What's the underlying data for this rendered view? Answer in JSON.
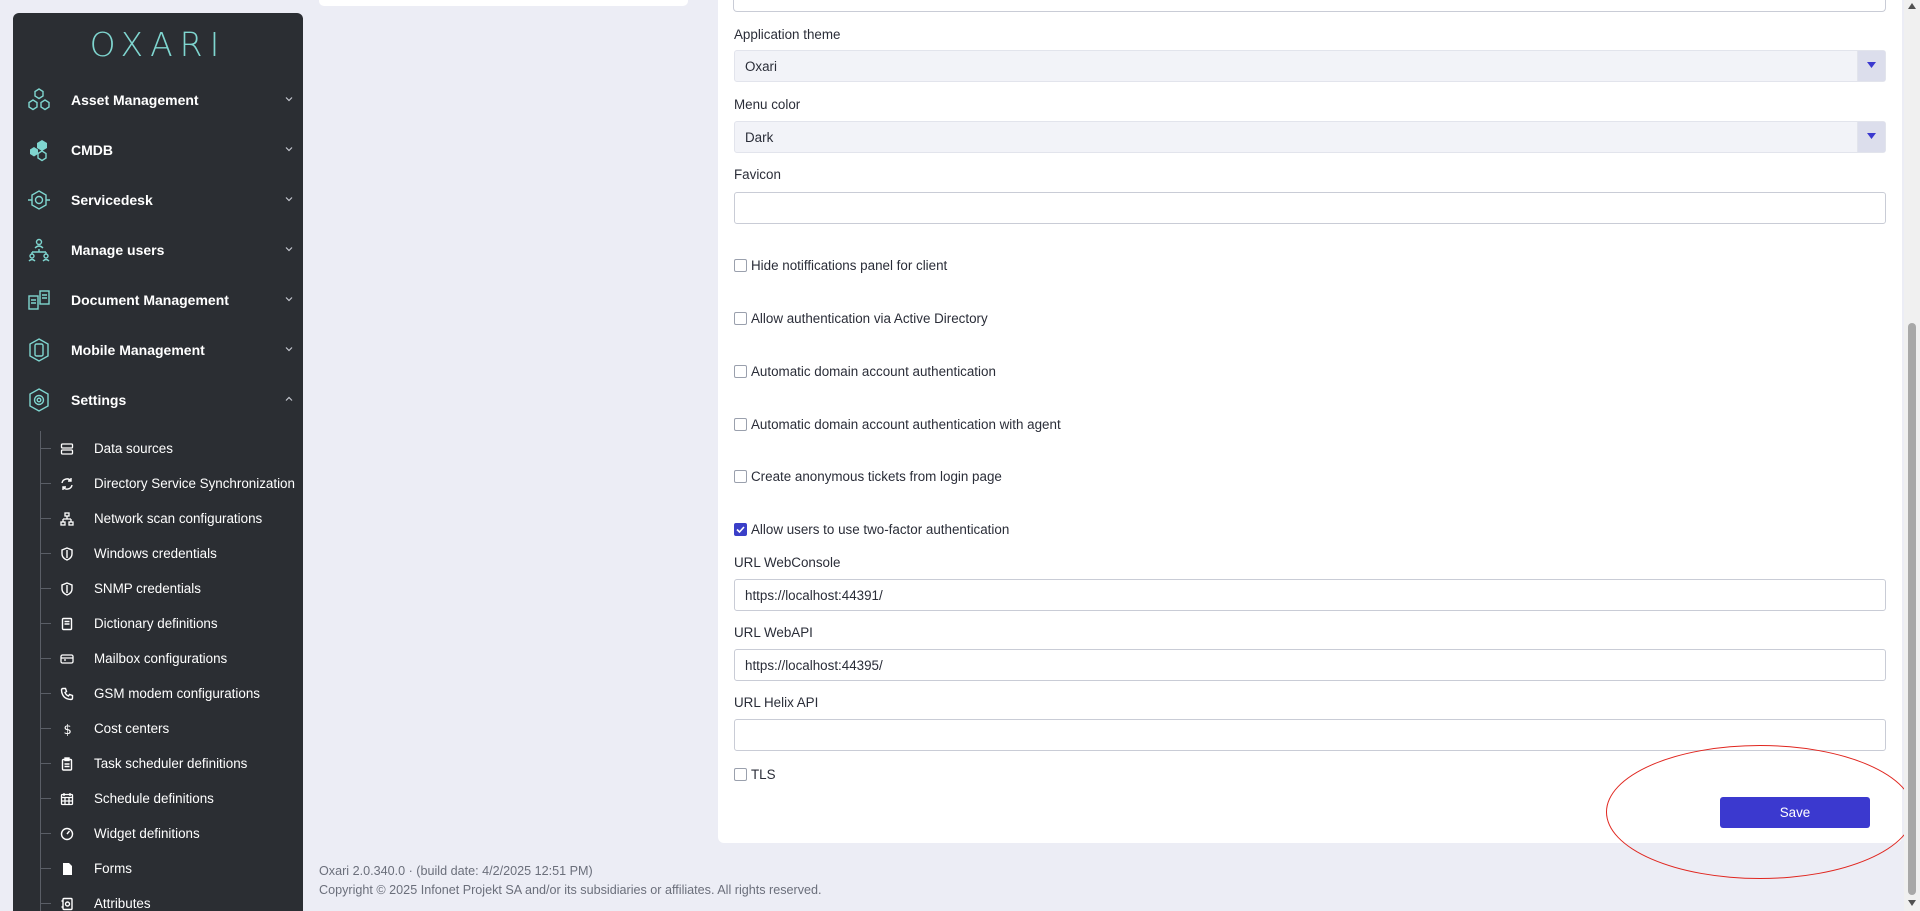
{
  "app": {
    "logo_text": "OXARI"
  },
  "sidebar": {
    "nav": [
      {
        "label": "Asset Management",
        "icon": "hexagon-cluster-icon"
      },
      {
        "label": "CMDB",
        "icon": "cmdb-icon"
      },
      {
        "label": "Servicedesk",
        "icon": "servicedesk-icon"
      },
      {
        "label": "Manage users",
        "icon": "users-hierarchy-icon"
      },
      {
        "label": "Document Management",
        "icon": "documents-icon"
      },
      {
        "label": "Mobile Management",
        "icon": "mobile-icon"
      },
      {
        "label": "Settings",
        "icon": "gear-icon",
        "expanded": true
      }
    ],
    "settings_items": [
      {
        "label": "Data sources",
        "icon": "server-icon"
      },
      {
        "label": "Directory Service Synchronization",
        "icon": "sync-icon"
      },
      {
        "label": "Network scan configurations",
        "icon": "network-icon"
      },
      {
        "label": "Windows credentials",
        "icon": "shield-icon"
      },
      {
        "label": "SNMP credentials",
        "icon": "shield-icon"
      },
      {
        "label": "Dictionary definitions",
        "icon": "book-icon"
      },
      {
        "label": "Mailbox configurations",
        "icon": "mailbox-icon"
      },
      {
        "label": "GSM modem configurations",
        "icon": "phone-icon"
      },
      {
        "label": "Cost centers",
        "icon": "dollar-icon"
      },
      {
        "label": "Task scheduler definitions",
        "icon": "clipboard-icon"
      },
      {
        "label": "Schedule definitions",
        "icon": "calendar-icon"
      },
      {
        "label": "Widget definitions",
        "icon": "gauge-icon"
      },
      {
        "label": "Forms",
        "icon": "file-icon"
      },
      {
        "label": "Attributes",
        "icon": "attributes-icon"
      }
    ]
  },
  "form": {
    "application_theme": {
      "label": "Application theme",
      "value": "Oxari"
    },
    "menu_color": {
      "label": "Menu color",
      "value": "Dark"
    },
    "favicon": {
      "label": "Favicon",
      "value": ""
    },
    "checkboxes": [
      {
        "label": "Hide notiffications panel for client",
        "checked": false
      },
      {
        "label": "Allow authentication via Active Directory",
        "checked": false
      },
      {
        "label": "Automatic domain account authentication",
        "checked": false
      },
      {
        "label": "Automatic domain account authentication with agent",
        "checked": false
      },
      {
        "label": "Create anonymous tickets from login page",
        "checked": false
      },
      {
        "label": "Allow users to use two-factor authentication",
        "checked": true
      }
    ],
    "url_webconsole": {
      "label": "URL WebConsole",
      "value": "https://localhost:44391/"
    },
    "url_webapi": {
      "label": "URL WebAPI",
      "value": "https://localhost:44395/"
    },
    "url_helix": {
      "label": "URL Helix API",
      "value": ""
    },
    "tls": {
      "label": "TLS",
      "checked": false
    },
    "save_label": "Save"
  },
  "footer": {
    "version": "Oxari 2.0.340.0  ·  (build date: 4/2/2025 12:51 PM)",
    "copyright": "Copyright © 2025 Infonet Projekt SA and/or its subsidiaries or affiliates. All rights reserved."
  },
  "colors": {
    "sidebar_bg": "#2b2e33",
    "accent": "#3b39cf",
    "logo": "#7fd6d0",
    "annotation": "#e0261f"
  }
}
